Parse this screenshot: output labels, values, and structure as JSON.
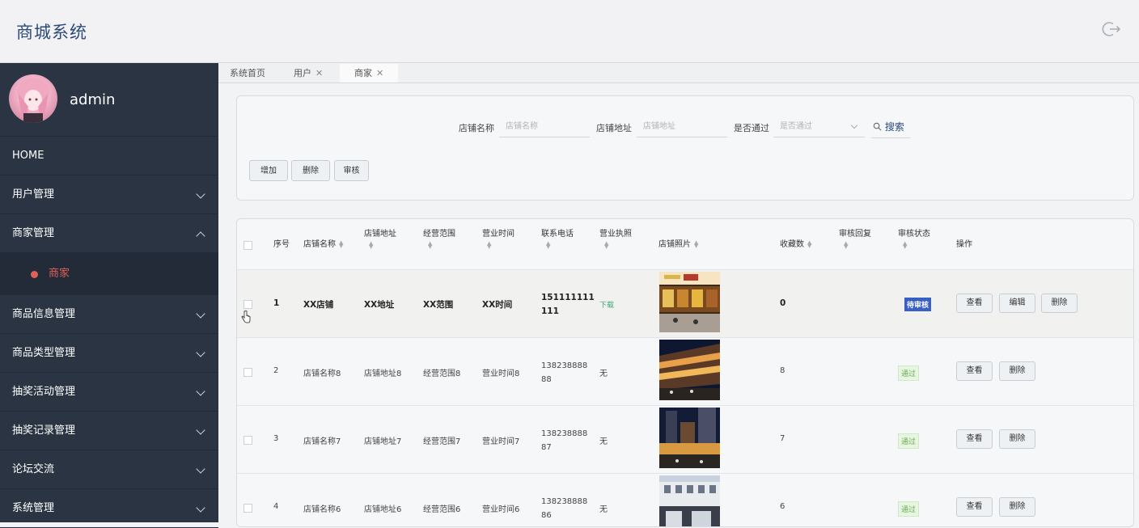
{
  "header": {
    "title": "商城系统",
    "logout_icon": "logout-icon"
  },
  "sidebar": {
    "username": "admin",
    "home": "HOME",
    "items": [
      {
        "label": "用户管理",
        "expanded": false
      },
      {
        "label": "商家管理",
        "expanded": true,
        "children": [
          {
            "label": "商家",
            "active": true
          }
        ]
      },
      {
        "label": "商品信息管理",
        "expanded": false
      },
      {
        "label": "商品类型管理",
        "expanded": false
      },
      {
        "label": "抽奖活动管理",
        "expanded": false
      },
      {
        "label": "抽奖记录管理",
        "expanded": false
      },
      {
        "label": "论坛交流",
        "expanded": false
      },
      {
        "label": "系统管理",
        "expanded": false
      }
    ]
  },
  "tabs": [
    {
      "label": "系统首页",
      "closable": false,
      "active": false
    },
    {
      "label": "用户",
      "closable": true,
      "active": false
    },
    {
      "label": "商家",
      "closable": true,
      "active": true
    }
  ],
  "search": {
    "shop_name_label": "店铺名称",
    "shop_name_placeholder": "店铺名称",
    "shop_addr_label": "店铺地址",
    "shop_addr_placeholder": "店铺地址",
    "passed_label": "是否通过",
    "passed_placeholder": "是否通过",
    "search_button": "搜索"
  },
  "actions": {
    "add": "增加",
    "delete": "删除",
    "audit": "审核"
  },
  "table": {
    "headers": {
      "index": "序号",
      "shop_name": "店铺名称",
      "shop_addr": "店铺地址",
      "scope": "经营范围",
      "hours": "营业时间",
      "phone": "联系电话",
      "license": "营业执照",
      "photo": "店铺照片",
      "favorites": "收藏数",
      "reply": "审核回复",
      "status": "审核状态",
      "ops": "操作"
    },
    "rows": [
      {
        "index": "1",
        "name": "XX店铺",
        "addr": "XX地址",
        "scope": "XX范围",
        "hours": "XX时间",
        "phone_1": "151111111",
        "phone_2": "111",
        "license": "下载",
        "favorites": "0",
        "status": "待审核",
        "status_type": "pending",
        "view": "查看",
        "edit": "编辑",
        "del": "删除"
      },
      {
        "index": "2",
        "name": "店铺名称8",
        "addr": "店铺地址8",
        "scope": "经营范围8",
        "hours": "营业时间8",
        "phone_1": "138238888",
        "phone_2": "88",
        "license": "无",
        "favorites": "8",
        "status": "通过",
        "status_type": "pass",
        "view": "查看",
        "del": "删除"
      },
      {
        "index": "3",
        "name": "店铺名称7",
        "addr": "店铺地址7",
        "scope": "经营范围7",
        "hours": "营业时间7",
        "phone_1": "138238888",
        "phone_2": "87",
        "license": "无",
        "favorites": "7",
        "status": "通过",
        "status_type": "pass",
        "view": "查看",
        "del": "删除"
      },
      {
        "index": "4",
        "name": "店铺名称6",
        "addr": "店铺地址6",
        "scope": "经营范围6",
        "hours": "营业时间6",
        "phone_1": "138238888",
        "phone_2": "86",
        "license": "无",
        "favorites": "6",
        "status": "通过",
        "status_type": "pass",
        "view": "查看",
        "del": "删除"
      }
    ]
  },
  "colors": {
    "sidebar_bg": "#2a3442",
    "active_menu": "#e0605a",
    "brand": "#2b4a78",
    "pass_green": "#67b04f",
    "license_green": "#3aa776"
  }
}
